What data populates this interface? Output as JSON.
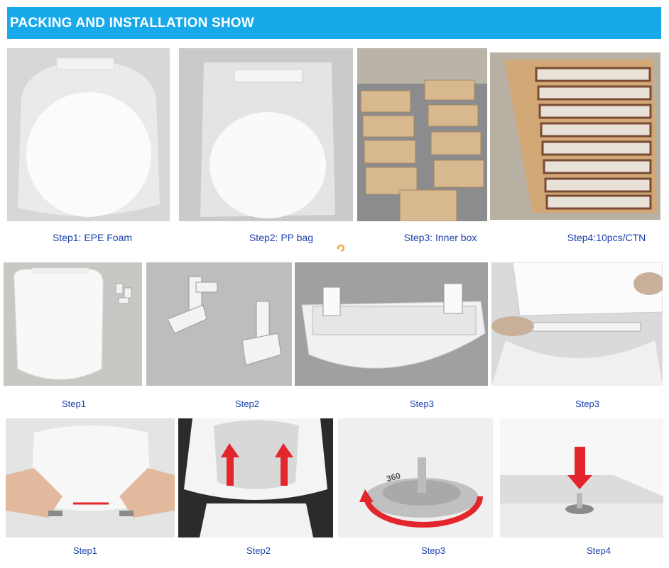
{
  "banner": {
    "title": "PACKING AND INSTALLATION SHOW"
  },
  "row1": [
    {
      "caption": "Step1: EPE Foam",
      "image": "toilet-seat-in-foam"
    },
    {
      "caption": "Step2: PP bag",
      "image": "toilet-seat-in-pp-bag"
    },
    {
      "caption": "Step3: Inner box",
      "image": "inner-boxes-stacked"
    },
    {
      "caption": "Step4:10pcs/CTN",
      "image": "carton-with-10-boxes"
    }
  ],
  "row2": [
    {
      "caption": "Step1",
      "image": "seat-and-hinge-parts"
    },
    {
      "caption": "Step2",
      "image": "hinge-fittings"
    },
    {
      "caption": "Step3",
      "image": "hinges-fitted-to-seat"
    },
    {
      "caption": "Step3",
      "image": "hinges-mounted-on-bowl"
    }
  ],
  "row3": [
    {
      "caption": "Step1",
      "image": "hands-pressing-buttons"
    },
    {
      "caption": "Step2",
      "image": "lift-seat-arrows"
    },
    {
      "caption": "Step3",
      "image": "rotate-360-hinge",
      "overlay_text": "360"
    },
    {
      "caption": "Step4",
      "image": "press-down-arrow"
    }
  ],
  "colors": {
    "banner": "#17a9ea",
    "caption": "#1a3fae",
    "arrow": "#e3262b"
  }
}
